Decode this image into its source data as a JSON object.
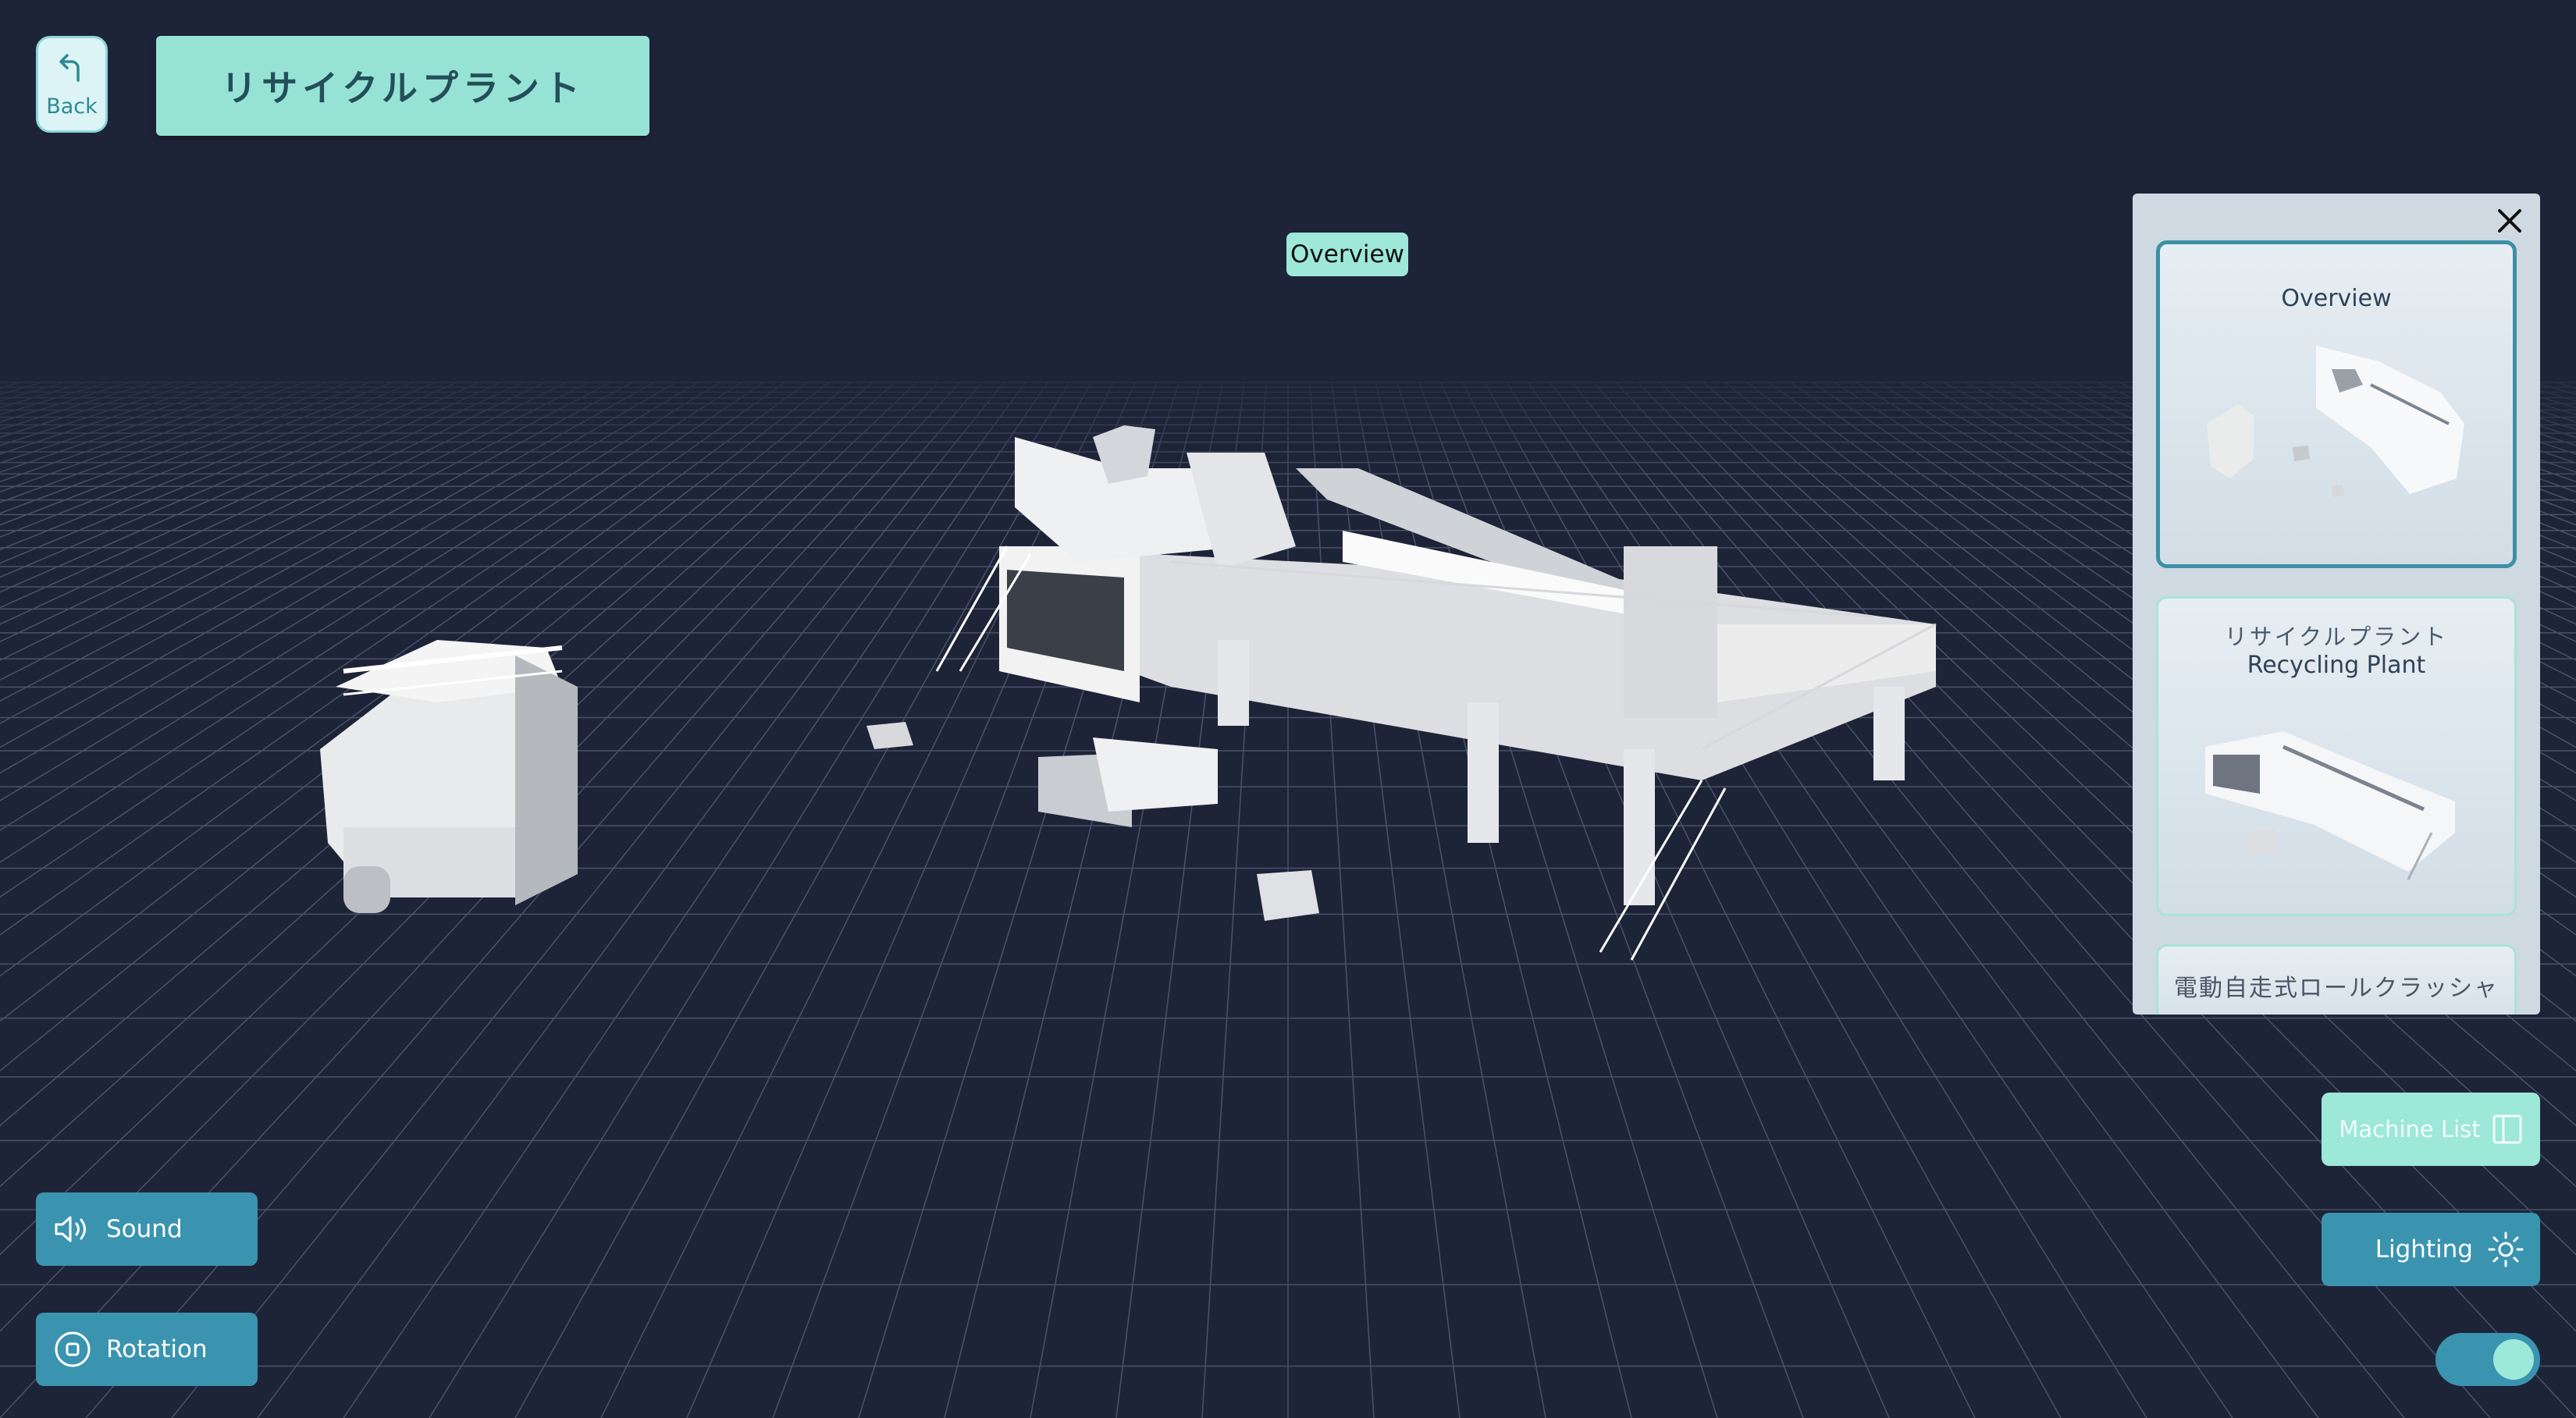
{
  "header": {
    "back_label": "Back",
    "title": "リサイクルプラント"
  },
  "viewport": {
    "view_tag": "Overview"
  },
  "panel": {
    "cards": [
      {
        "label": "Overview"
      },
      {
        "label_jp": "リサイクルプラント",
        "label_en": "Recycling Plant"
      },
      {
        "label": "電動自走式ロールクラッシャ"
      }
    ]
  },
  "controls": {
    "sound_label": "Sound",
    "rotation_label": "Rotation",
    "machine_list_label": "Machine List",
    "lighting_label": "Lighting",
    "lighting_toggle_on": true
  },
  "colors": {
    "background": "#1e2438",
    "accent": "#3a94b0",
    "mint": "#9de8d8"
  },
  "icons": {
    "back": "back-arrow-icon",
    "close": "close-icon",
    "sound": "speaker-icon",
    "rotation": "rotation-icon",
    "machine_list": "sidebar-panel-icon",
    "lighting": "sun-icon"
  }
}
